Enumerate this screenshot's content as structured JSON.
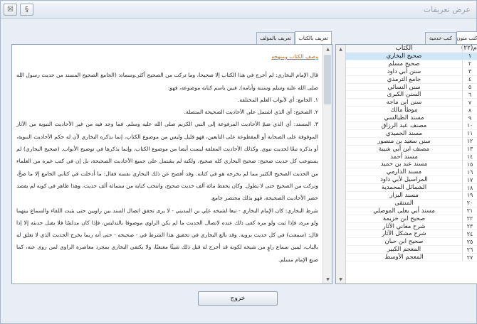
{
  "window": {
    "title": "عرض تعريفات"
  },
  "titlebar": {
    "close_glyph": "☒",
    "help_glyph": "§"
  },
  "right_tabs": [
    "كتب متون",
    "كتب خدمية"
  ],
  "left_tabs": [
    "تعريف بالكتاب",
    "تعريف بالمؤلف"
  ],
  "books_table": {
    "count_header": "م(٢٢)",
    "title_header": "الكتاب",
    "rows": [
      {
        "num": "١",
        "book": "صحيح البخاري"
      },
      {
        "num": "٢",
        "book": "صحيح مسلم"
      },
      {
        "num": "٣",
        "book": "سنن أبي داود"
      },
      {
        "num": "٤",
        "book": "جامع الترمذي"
      },
      {
        "num": "٥",
        "book": "سنن النسائي"
      },
      {
        "num": "٦",
        "book": "السنن الكبرى"
      },
      {
        "num": "٧",
        "book": "سنن ابن ماجه"
      },
      {
        "num": "٨",
        "book": "موطأ مالك"
      },
      {
        "num": "٩",
        "book": "مسند الطيالسي"
      },
      {
        "num": "١٠",
        "book": "مصنف عبد الرزاق"
      },
      {
        "num": "١١",
        "book": "مسند الحميدي"
      },
      {
        "num": "١٢",
        "book": "سنن سعيد بن منصور"
      },
      {
        "num": "١٣",
        "book": "مصنف ابن أبي شيبة"
      },
      {
        "num": "١٤",
        "book": "مسند أحمد"
      },
      {
        "num": "١٥",
        "book": "مسند عبد بن حميد"
      },
      {
        "num": "١٦",
        "book": "مسند الدارمي"
      },
      {
        "num": "١٧",
        "book": "المراسيل لأبي داود"
      },
      {
        "num": "١٨",
        "book": "الشمائل المحمدية"
      },
      {
        "num": "١٩",
        "book": "مسند البزار"
      },
      {
        "num": "٢٠",
        "book": "المنتقى"
      },
      {
        "num": "٢١",
        "book": "مسند أبي يعلى الموصلي"
      },
      {
        "num": "٢٢",
        "book": "صحيح ابن خزيمة"
      },
      {
        "num": "٢٣",
        "book": "شرح معاني الآثار"
      },
      {
        "num": "٢٤",
        "book": "شرح مشكل الآثار"
      },
      {
        "num": "٢٥",
        "book": "صحيح ابن حبان"
      },
      {
        "num": "٢٦",
        "book": "المعجم الكبير"
      },
      {
        "num": "٢٧",
        "book": "المعجم الأوسط"
      }
    ]
  },
  "description": {
    "heading": "وصف الكتاب ومنهجه",
    "paragraphs": [
      "قال الإمام البخاري: لم أخرج في هذا الكتاب إلا صحيحا، وما تركت من الصحيح أكثر.وسماه: (الجامع الصحيح المسند من حديث رسول الله صلى الله عليه وسلم وسننه وأيامه). فبين باسم كتابه موضوعه، فهو:",
      "١. الجامع: أي لأبواب العلم المختلفة.",
      "٢. الصحيح: أي الذي اشتمل على الأحاديث الصحيحة المتصلة.",
      "٣. المسند: أي الذي ضمّ الأحاديث المرفوعة إلى النبي الكريم صلى الله عليه وسلم. فما وجد فيه من غير الأحاديث النبوية من الآثار الموقوفة على الصحابة أو المقطوعة على التابعين، فهو قليل وليس من موضوع الكتاب، إنما يذكره البخاري لأن له حكم الأحاديث النبوية، أو يذكره تبعًا لحديث نبوي. وكذلك الأحاديث المعلقة ليست أيضا من موضوع الكتاب، وإنما يذكرها في توضيح الأبواب. (صحيح البخاري) لم يستوعب كل حديث صحيح: صحيح البخاري كله صحيح، ولكنه لم يشتمل على جميع الأحاديث الصحيحة، بل إن في كتب غيره من العلماء من الحديث الصحيح الكثير مما لم يخرجه هو في كتابه. وقد أفصح عن ذلك البخاري نفسه فقال: ما أدخلت في كتابي الجامع إلا ما صحَّ، وتركت من الصحيح حتى لا يطول. وكان يحفظ مائة ألف حديث صحيح، وانتخب كتابه من ستمائة ألف حديث، وهذا ظاهر في كونه لم يقصد حصر الأحاديث الصحيحة، فهو بذلك مختصر جامع.",
      "شرط البخاري: كان الإمام البخاري - تبعا لشيخه علي بن المديني - لا يرى تحقق اتصال السند بين راويين حتى يثبت اللقاء والسماع بينهما ولو مرة، فإذا ثبت ولو مرة كفى ذلك عنده لاتصال الحديث ما لم يكن الراوي موصوفا بالتدليس، فإذا كان مدلسًا فلا يقبل حديثه إلا إذا قال: (سمعت) في كل حديث يرويه. وقد بالغ البخاري في تحقيق هذا الشرط في - صحيحه - حتى أنه ربما يخرج الحديث الذي لا تعلق له بالباب، ليبين سماع راوٍ من شيخه لكونه قد أخرج له قبل ذلك شيئًا معنعنًا، ولا يكتفي البخاري بمجرد معاصرة الراوي لمن روى عنه، كما صنع الإمام مسلم."
    ]
  },
  "footer": {
    "exit_label": "خروج"
  },
  "colors": {
    "selected_row": "#cfe6f7",
    "heading": "#c86b1a",
    "pane_border": "#8fa1b8"
  },
  "icons": [
    "close-icon",
    "help-icon",
    "scroll-up-icon",
    "scroll-down-icon"
  ]
}
